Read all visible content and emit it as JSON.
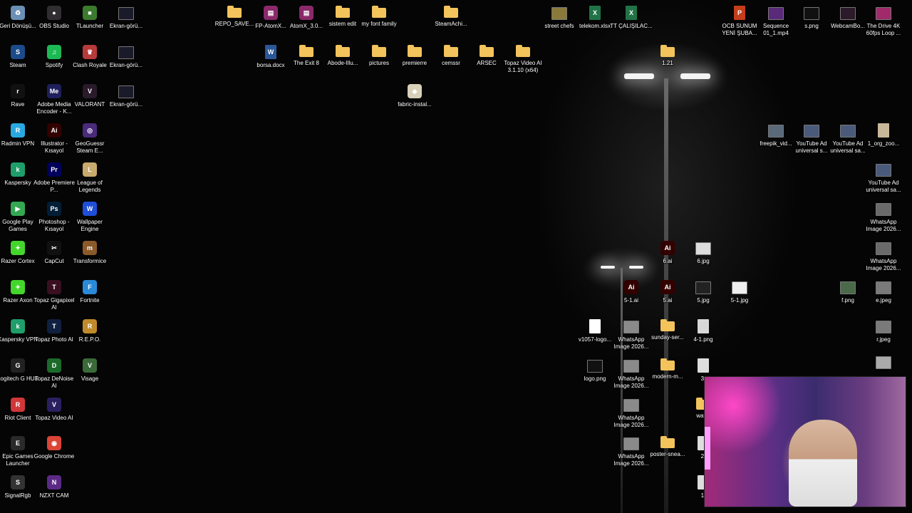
{
  "desktop": {
    "icons": [
      {
        "id": "geri-donusum",
        "label": "Geri Dönüşü...",
        "glyph": "recycle-bin-icon",
        "color": "#6b8fb5",
        "kind": "app"
      },
      {
        "id": "steam",
        "label": "Steam",
        "glyph": "steam-icon",
        "color": "#1b4b8a",
        "kind": "app"
      },
      {
        "id": "rave",
        "label": "Rave",
        "glyph": "rave-icon",
        "color": "#111111",
        "kind": "app"
      },
      {
        "id": "radmin-vpn",
        "label": "Radmin VPN",
        "glyph": "radmin-vpn-icon",
        "color": "#2aa8e0",
        "kind": "app"
      },
      {
        "id": "kaspersky",
        "label": "Kaspersky",
        "glyph": "kaspersky-icon",
        "color": "#1f9e6a",
        "kind": "app"
      },
      {
        "id": "google-play-games",
        "label": "Google Play Games",
        "glyph": "google-play-games-icon",
        "color": "#34a853",
        "kind": "app"
      },
      {
        "id": "razer-cortex",
        "label": "Razer Cortex",
        "glyph": "razer-cortex-icon",
        "color": "#44d62c",
        "kind": "app"
      },
      {
        "id": "razer-axon",
        "label": "Razer Axon",
        "glyph": "razer-axon-icon",
        "color": "#44d62c",
        "kind": "app"
      },
      {
        "id": "kaspersky-vpn",
        "label": "Kaspersky VPN",
        "glyph": "kaspersky-vpn-icon",
        "color": "#1f9e6a",
        "kind": "app"
      },
      {
        "id": "logitech",
        "label": "Logitech G HUB",
        "glyph": "logitech-icon",
        "color": "#222222",
        "kind": "app"
      },
      {
        "id": "riot-client",
        "label": "Riot Client",
        "glyph": "riot-client-icon",
        "color": "#d13639",
        "kind": "app"
      },
      {
        "id": "epic-games",
        "label": "Epic Games Launcher",
        "glyph": "epic-games-icon",
        "color": "#2a2a2a",
        "kind": "app"
      },
      {
        "id": "signalrgb",
        "label": "SignalRgb",
        "glyph": "signalrgb-icon",
        "color": "#333333",
        "kind": "app"
      },
      {
        "id": "obs-studio",
        "label": "OBS Studio",
        "glyph": "obs-icon",
        "color": "#302e31",
        "kind": "app"
      },
      {
        "id": "spotify",
        "label": "Spotify",
        "glyph": "spotify-icon",
        "color": "#1db954",
        "kind": "app"
      },
      {
        "id": "adobe-media-encoder",
        "label": "Adobe Media Encoder - K...",
        "glyph": "media-encoder-icon",
        "color": "#1f1f5c",
        "kind": "app"
      },
      {
        "id": "illustrator",
        "label": "Illustrator - Kısayol",
        "glyph": "illustrator-icon",
        "color": "#330000",
        "kind": "app"
      },
      {
        "id": "premiere",
        "label": "Adobe Premiere P...",
        "glyph": "premiere-icon",
        "color": "#00005b",
        "kind": "app"
      },
      {
        "id": "photoshop",
        "label": "Photoshop - Kısayol",
        "glyph": "photoshop-icon",
        "color": "#001e36",
        "kind": "app"
      },
      {
        "id": "capcut",
        "label": "CapCut",
        "glyph": "capcut-icon",
        "color": "#111111",
        "kind": "app"
      },
      {
        "id": "topaz-gigapixel",
        "label": "Topaz Gigapixel AI",
        "glyph": "topaz-gigapixel-icon",
        "color": "#3a1020",
        "kind": "app"
      },
      {
        "id": "topaz-photo",
        "label": "Topaz Photo AI",
        "glyph": "topaz-photo-icon",
        "color": "#102040",
        "kind": "app"
      },
      {
        "id": "topaz-denoise",
        "label": "Topaz DeNoise AI",
        "glyph": "topaz-denoise-icon",
        "color": "#1b6a2a",
        "kind": "app"
      },
      {
        "id": "topaz-video",
        "label": "Topaz Video AI",
        "glyph": "topaz-video-icon",
        "color": "#2a2060",
        "kind": "app"
      },
      {
        "id": "google-chrome",
        "label": "Google Chrome",
        "glyph": "chrome-icon",
        "color": "#db4437",
        "kind": "app"
      },
      {
        "id": "nzxt-cam",
        "label": "NZXT CAM",
        "glyph": "nzxt-cam-icon",
        "color": "#5b2a86",
        "kind": "app"
      },
      {
        "id": "tlauncher",
        "label": "TLauncher",
        "glyph": "tlauncher-icon",
        "color": "#3c7a2e",
        "kind": "app"
      },
      {
        "id": "clash-royale",
        "label": "Clash Royale",
        "glyph": "clash-royale-icon",
        "color": "#b83a3a",
        "kind": "app"
      },
      {
        "id": "valorant",
        "label": "VALORANT",
        "glyph": "valorant-icon",
        "color": "#2a1a2a",
        "kind": "app"
      },
      {
        "id": "geoguessr",
        "label": "GeoGuessr Steam E...",
        "glyph": "geoguessr-icon",
        "color": "#4a2a7a",
        "kind": "app"
      },
      {
        "id": "league-of-legends",
        "label": "League of Legends",
        "glyph": "league-icon",
        "color": "#c8aa6e",
        "kind": "app"
      },
      {
        "id": "wallpaper-engine",
        "label": "Wallpaper Engine",
        "glyph": "wallpaper-engine-icon",
        "color": "#1f4fd8",
        "kind": "app"
      },
      {
        "id": "transformice",
        "label": "Transformice",
        "glyph": "transformice-icon",
        "color": "#8a5a2a",
        "kind": "app"
      },
      {
        "id": "fortnite",
        "label": "Fortnite",
        "glyph": "fortnite-icon",
        "color": "#2a8ad8",
        "kind": "app"
      },
      {
        "id": "repo",
        "label": "R.E.P.O.",
        "glyph": "repo-game-icon",
        "color": "#c08a2a",
        "kind": "app"
      },
      {
        "id": "visage",
        "label": "Visage",
        "glyph": "visage-icon",
        "color": "#3a6a3a",
        "kind": "app"
      },
      {
        "id": "ekran-1",
        "label": "Ekran-görü...",
        "glyph": "image-file-icon",
        "color": "#1a1a2a",
        "kind": "thumb"
      },
      {
        "id": "ekran-2",
        "label": "Ekran-görü...",
        "glyph": "image-file-icon",
        "color": "#1a1a2a",
        "kind": "thumb"
      },
      {
        "id": "ekran-3",
        "label": "Ekran-görü...",
        "glyph": "image-file-icon",
        "color": "#1a1a2a",
        "kind": "thumb"
      },
      {
        "id": "repo-save",
        "label": "REPO_SAVE...",
        "glyph": "folder-icon",
        "color": "#f3c35c",
        "kind": "folder"
      },
      {
        "id": "fp-atomx",
        "label": "FP-AtomX...",
        "glyph": "winrar-icon",
        "color": "#8a2a6a",
        "kind": "app"
      },
      {
        "id": "atomx-3",
        "label": "AtomX_3.0...",
        "glyph": "winrar-icon",
        "color": "#8a2a6a",
        "kind": "app"
      },
      {
        "id": "sistem-edit",
        "label": "sistem edit",
        "glyph": "folder-icon",
        "color": "#f3c35c",
        "kind": "folder"
      },
      {
        "id": "my-font-family",
        "label": "my font family",
        "glyph": "folder-icon",
        "color": "#f3c35c",
        "kind": "folder"
      },
      {
        "id": "steamachi",
        "label": "SteamAchi...",
        "glyph": "folder-icon",
        "color": "#f3c35c",
        "kind": "folder"
      },
      {
        "id": "borsa-docx",
        "label": "borsa.docx",
        "glyph": "word-doc-icon",
        "color": "#2b579a",
        "kind": "doc"
      },
      {
        "id": "the-exit-8",
        "label": "The Exit 8",
        "glyph": "folder-icon",
        "color": "#f3c35c",
        "kind": "folder"
      },
      {
        "id": "abode-illu",
        "label": "Abode-Illu...",
        "glyph": "folder-icon",
        "color": "#f3c35c",
        "kind": "folder"
      },
      {
        "id": "pictures",
        "label": "pictures",
        "glyph": "folder-icon",
        "color": "#f3c35c",
        "kind": "folder"
      },
      {
        "id": "premierre",
        "label": "premierre",
        "glyph": "folder-icon",
        "color": "#f3c35c",
        "kind": "folder"
      },
      {
        "id": "cemssr",
        "label": "cemssr",
        "glyph": "folder-icon",
        "color": "#f3c35c",
        "kind": "folder"
      },
      {
        "id": "arsec",
        "label": "ARSEC",
        "glyph": "folder-icon",
        "color": "#f3c35c",
        "kind": "folder"
      },
      {
        "id": "topaz-video-folder",
        "label": "Topaz Video AI 3.1.10 (x64)",
        "glyph": "folder-icon",
        "color": "#f3c35c",
        "kind": "folder"
      },
      {
        "id": "fabric-installer",
        "label": "fabric-instal...",
        "glyph": "installer-icon",
        "color": "#d8d0b8",
        "kind": "app"
      },
      {
        "id": "street-chefs",
        "label": "street chefs",
        "glyph": "image-file-icon",
        "color": "#8a7a3a",
        "kind": "thumb"
      },
      {
        "id": "telekom-xlsx",
        "label": "telekom.xlsx",
        "glyph": "excel-doc-icon",
        "color": "#217346",
        "kind": "doc"
      },
      {
        "id": "tt-calisilac",
        "label": "TT ÇALIŞILAC...",
        "glyph": "excel-doc-icon",
        "color": "#217346",
        "kind": "doc"
      },
      {
        "id": "folder-121",
        "label": "1.21",
        "glyph": "folder-icon",
        "color": "#f3c35c",
        "kind": "folder"
      },
      {
        "id": "ocb-sunum",
        "label": "OCB SUNUM YENİ ŞUBA...",
        "glyph": "powerpoint-doc-icon",
        "color": "#c43e1c",
        "kind": "doc"
      },
      {
        "id": "sequence-01",
        "label": "Sequence 01_1.mp4",
        "glyph": "video-file-icon",
        "color": "#5a2a7a",
        "kind": "thumb"
      },
      {
        "id": "s-png",
        "label": "s.png",
        "glyph": "image-file-icon",
        "color": "#111111",
        "kind": "thumb"
      },
      {
        "id": "webcambo",
        "label": "WebcamBo...",
        "glyph": "image-file-icon",
        "color": "#2a1a2a",
        "kind": "thumb"
      },
      {
        "id": "the-drive-4k",
        "label": "The Drive 4K 60fps Loop ...",
        "glyph": "video-file-icon",
        "color": "#a02a6a",
        "kind": "thumb"
      },
      {
        "id": "freepik-vid",
        "label": "freepik_vid...",
        "glyph": "video-file-icon",
        "color": "#5a6a7a",
        "kind": "thumb"
      },
      {
        "id": "youtube-ad-1",
        "label": "YouTube Ad universal s...",
        "glyph": "video-file-icon",
        "color": "#4a5a7a",
        "kind": "thumb"
      },
      {
        "id": "youtube-ad-2",
        "label": "YouTube Ad universal sa...",
        "glyph": "video-file-icon",
        "color": "#4a5a7a",
        "kind": "thumb"
      },
      {
        "id": "org-zoo",
        "label": "1_org_zoo...",
        "glyph": "image-file-icon",
        "color": "#c8b89a",
        "kind": "doc"
      },
      {
        "id": "youtube-ad-3",
        "label": "YouTube Ad universal sa...",
        "glyph": "video-file-icon",
        "color": "#4a5a7a",
        "kind": "thumb"
      },
      {
        "id": "whatsapp-r1",
        "label": "WhatsApp Image 2026...",
        "glyph": "image-file-icon",
        "color": "#6a6a6a",
        "kind": "thumb"
      },
      {
        "id": "whatsapp-r2",
        "label": "WhatsApp Image 2026...",
        "glyph": "image-file-icon",
        "color": "#6a6a6a",
        "kind": "thumb"
      },
      {
        "id": "f-png",
        "label": "f.png",
        "glyph": "image-file-icon",
        "color": "#4a6a4a",
        "kind": "thumb"
      },
      {
        "id": "e-jpeg",
        "label": "e.jpeg",
        "glyph": "image-file-icon",
        "color": "#7a7a7a",
        "kind": "thumb"
      },
      {
        "id": "r-jpeg",
        "label": "r.jpeg",
        "glyph": "image-file-icon",
        "color": "#7a7a7a",
        "kind": "thumb"
      },
      {
        "id": "unlabeled-right",
        "label": "",
        "glyph": "image-file-icon",
        "color": "#aaaaaa",
        "kind": "thumb"
      },
      {
        "id": "ai-6",
        "label": "6.ai",
        "glyph": "illustrator-file-icon",
        "color": "#330000",
        "kind": "app"
      },
      {
        "id": "jpg-6",
        "label": "6.jpg",
        "glyph": "image-file-icon",
        "color": "#dddddd",
        "kind": "thumb"
      },
      {
        "id": "ai-5-1",
        "label": "5-1.ai",
        "glyph": "illustrator-file-icon",
        "color": "#330000",
        "kind": "app"
      },
      {
        "id": "ai-5",
        "label": "5.ai",
        "glyph": "illustrator-file-icon",
        "color": "#330000",
        "kind": "app"
      },
      {
        "id": "jpg-5",
        "label": "5.jpg",
        "glyph": "image-file-icon",
        "color": "#222222",
        "kind": "thumb"
      },
      {
        "id": "jpg-5-1",
        "label": "5-1.jpg",
        "glyph": "image-file-icon",
        "color": "#eeeeee",
        "kind": "thumb"
      },
      {
        "id": "v1057-logo",
        "label": "v1057-logo...",
        "glyph": "image-file-icon",
        "color": "#ffffff",
        "kind": "doc"
      },
      {
        "id": "whatsapp-1",
        "label": "WhatsApp Image 2026...",
        "glyph": "image-file-icon",
        "color": "#8a8a8a",
        "kind": "thumb"
      },
      {
        "id": "sunday-ser",
        "label": "sunday-ser...",
        "glyph": "folder-icon",
        "color": "#f3c35c",
        "kind": "folder"
      },
      {
        "id": "png-4-1",
        "label": "4-1.png",
        "glyph": "image-file-icon",
        "color": "#d8d8d8",
        "kind": "doc"
      },
      {
        "id": "logo-png",
        "label": "logo.png",
        "glyph": "image-file-icon",
        "color": "#111111",
        "kind": "thumb"
      },
      {
        "id": "whatsapp-2",
        "label": "WhatsApp Image 2026...",
        "glyph": "image-file-icon",
        "color": "#8a8a8a",
        "kind": "thumb"
      },
      {
        "id": "modern-m",
        "label": "modern-m...",
        "glyph": "folder-icon",
        "color": "#f3c35c",
        "kind": "folder"
      },
      {
        "id": "partial-3",
        "label": "3.",
        "glyph": "image-file-icon",
        "color": "#dddddd",
        "kind": "doc"
      },
      {
        "id": "whatsapp-3",
        "label": "WhatsApp Image 2026...",
        "glyph": "image-file-icon",
        "color": "#8a8a8a",
        "kind": "thumb"
      },
      {
        "id": "water",
        "label": "water",
        "glyph": "folder-icon",
        "color": "#f3c35c",
        "kind": "folder"
      },
      {
        "id": "whatsapp-4",
        "label": "WhatsApp Image 2026...",
        "glyph": "image-file-icon",
        "color": "#8a8a8a",
        "kind": "thumb"
      },
      {
        "id": "poster-snea",
        "label": "poster-snea...",
        "glyph": "folder-icon",
        "color": "#f3c35c",
        "kind": "folder"
      },
      {
        "id": "partial-2",
        "label": "2.",
        "glyph": "image-file-icon",
        "color": "#dddddd",
        "kind": "doc"
      },
      {
        "id": "partial-1",
        "label": "1.",
        "glyph": "image-file-icon",
        "color": "#dddddd",
        "kind": "doc"
      }
    ]
  }
}
